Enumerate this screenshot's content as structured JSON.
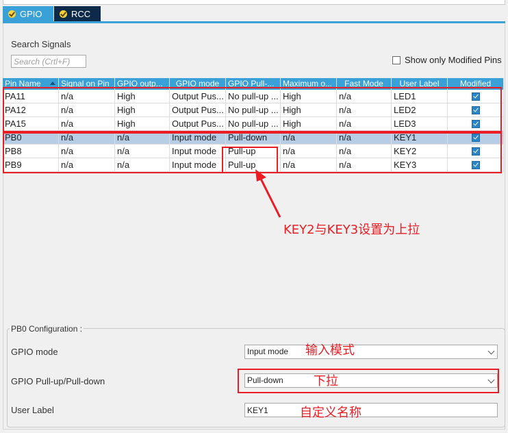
{
  "tabs": [
    {
      "label": "GPIO"
    },
    {
      "label": "RCC"
    }
  ],
  "search": {
    "title": "Search Signals",
    "placeholder": "Search (Crtl+F)",
    "show_modified_label": "Show only Modified Pins"
  },
  "table": {
    "headers": [
      "Pin Name",
      "Signal on Pin",
      "GPIO outp...",
      "GPIO mode",
      "GPIO Pull-...",
      "Maximum o...",
      "Fast Mode",
      "User Label",
      "Modified"
    ],
    "rows": [
      [
        "PA11",
        "n/a",
        "High",
        "Output Pus...",
        "No pull-up ...",
        "High",
        "n/a",
        "LED1"
      ],
      [
        "PA12",
        "n/a",
        "High",
        "Output Pus...",
        "No pull-up ...",
        "High",
        "n/a",
        "LED2"
      ],
      [
        "PA15",
        "n/a",
        "High",
        "Output Pus...",
        "No pull-up ...",
        "High",
        "n/a",
        "LED3"
      ],
      [
        "PB0",
        "n/a",
        "n/a",
        "Input mode",
        "Pull-down",
        "n/a",
        "n/a",
        "KEY1"
      ],
      [
        "PB8",
        "n/a",
        "n/a",
        "Input mode",
        "Pull-up",
        "n/a",
        "n/a",
        "KEY2"
      ],
      [
        "PB9",
        "n/a",
        "n/a",
        "Input mode",
        "Pull-up",
        "n/a",
        "n/a",
        "KEY3"
      ]
    ]
  },
  "annotations": {
    "pullup_note": "KEY2与KEY3设置为上拉",
    "mode_note": "输入模式",
    "pull_note": "下拉",
    "label_note": "自定义名称"
  },
  "config": {
    "title": "PB0 Configuration :",
    "gpio_mode_label": "GPIO mode",
    "gpio_mode_value": "Input mode",
    "pull_label": "GPIO Pull-up/Pull-down",
    "pull_value": "Pull-down",
    "user_label_label": "User Label",
    "user_label_value": "KEY1"
  },
  "colors": {
    "accent": "#3aa0d8",
    "annotation": "#ec1c24",
    "selected_row": "#b7cde6"
  }
}
